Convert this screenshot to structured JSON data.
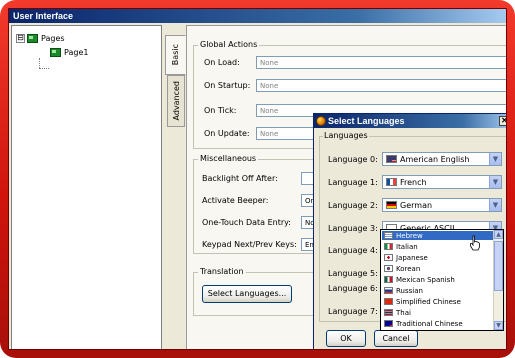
{
  "window": {
    "title": "User Interface"
  },
  "tree": {
    "root_expander": "⊟",
    "items": [
      {
        "label": "Pages"
      },
      {
        "label": "Page1"
      }
    ]
  },
  "tabs": [
    {
      "label": "Basic"
    },
    {
      "label": "Advanced"
    }
  ],
  "global_actions": {
    "title": "Global Actions",
    "fields": [
      {
        "label": "On Load:",
        "value": "None"
      },
      {
        "label": "On Startup:",
        "value": "None"
      },
      {
        "label": "On Tick:",
        "value": "None"
      },
      {
        "label": "On Update:",
        "value": "None"
      }
    ]
  },
  "miscellaneous": {
    "title": "Miscellaneous",
    "fields": [
      {
        "label": "Backlight Off After:",
        "value": ""
      },
      {
        "label": "Activate Beeper:",
        "value": "On"
      },
      {
        "label": "One-Touch Data Entry:",
        "value": "No"
      },
      {
        "label": "Keypad Next/Prev Keys:",
        "value": "Ena"
      }
    ]
  },
  "translation": {
    "title": "Translation",
    "button_label": "Select Languages..."
  },
  "dialog": {
    "title": "Select Languages",
    "close": "✕",
    "group_title": "Languages",
    "languages": [
      {
        "label": "Language 0:",
        "value": "American English",
        "flag": "us-flag"
      },
      {
        "label": "Language 1:",
        "value": "French",
        "flag": "fr-flag"
      },
      {
        "label": "Language 2:",
        "value": "German",
        "flag": "de-flag"
      },
      {
        "label": "Language 3:",
        "value": "Generic ASCII",
        "flag": "blank-flag"
      },
      {
        "label": "Language 4:",
        "value": ""
      },
      {
        "label": "Language 5:",
        "value": ""
      },
      {
        "label": "Language 6:",
        "value": ""
      },
      {
        "label": "Language 7:",
        "value": ""
      }
    ],
    "ok_label": "OK",
    "cancel_label": "Cancel"
  },
  "dropdown": {
    "selected": "Hebrew",
    "options": [
      {
        "label": "Hebrew",
        "flag": "il-flag"
      },
      {
        "label": "Italian",
        "flag": "it-flag"
      },
      {
        "label": "Japanese",
        "flag": "jp-flag"
      },
      {
        "label": "Korean",
        "flag": "kr-flag"
      },
      {
        "label": "Mexican Spanish",
        "flag": "mx-flag"
      },
      {
        "label": "Russian",
        "flag": "ru-flag"
      },
      {
        "label": "Simplified Chinese",
        "flag": "cn-flag"
      },
      {
        "label": "Thai",
        "flag": "th-flag"
      },
      {
        "label": "Traditional Chinese",
        "flag": "tw-flag"
      }
    ]
  },
  "colors": {
    "frame": "#d0140c",
    "title_bar": "#0a246a",
    "selection": "#316ac5",
    "window_bg": "#ece9d8"
  }
}
